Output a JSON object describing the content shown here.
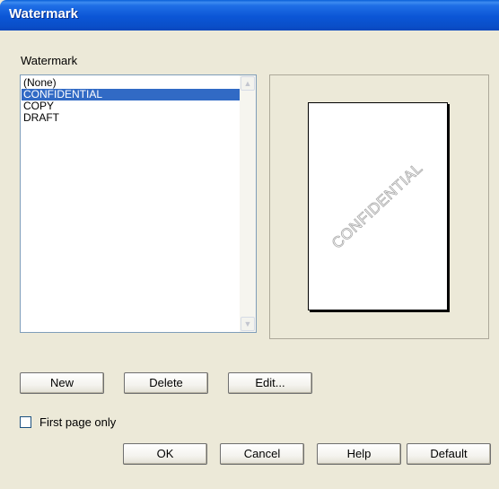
{
  "window": {
    "title": "Watermark"
  },
  "group_label": "Watermark",
  "watermark_list": {
    "items": [
      "(None)",
      "CONFIDENTIAL",
      "COPY",
      "DRAFT"
    ],
    "selected": "CONFIDENTIAL"
  },
  "preview": {
    "watermark_text": "CONFIDENTIAL"
  },
  "buttons": {
    "new": "New",
    "delete": "Delete",
    "edit": "Edit...",
    "ok": "OK",
    "cancel": "Cancel",
    "help": "Help",
    "default": "Default"
  },
  "first_page_only": {
    "label": "First page only",
    "checked": false
  },
  "icons": {
    "scroll_up": "scroll-up-arrow-icon",
    "scroll_down": "scroll-down-arrow-icon"
  },
  "colors": {
    "selection": "#316ac5",
    "title_bar": "#0a54d3",
    "dialog_bg": "#ece9d8"
  }
}
